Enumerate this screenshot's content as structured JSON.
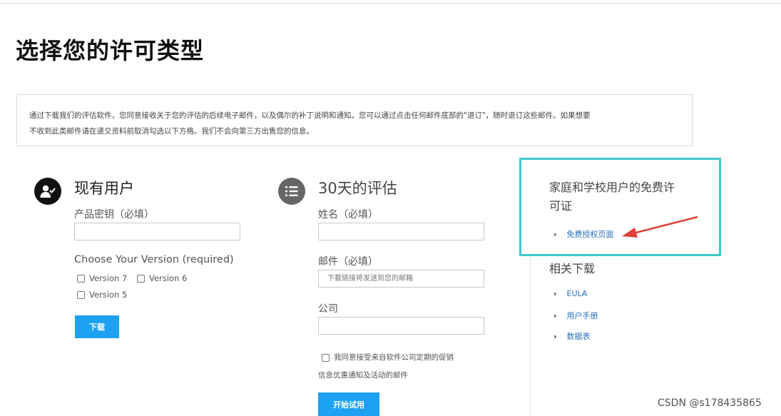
{
  "page": {
    "title": "选择您的许可类型",
    "notice_line1": "通过下载我们的评估软件，您同意接收关于您的评估的后续电子邮件，以及偶尔的补丁说明和通知。您可以通过点击任何邮件底部的\"退订\"，随时退订这些邮件。如果想要",
    "notice_line2": "不收到此类邮件请在递交资料前取消勾选以下方格。我们不会向第三方出售您的信息。"
  },
  "existing_user": {
    "title": "现有用户",
    "icon": "user-check-icon",
    "product_key_label": "产品密钥（必填）",
    "product_key_value": "",
    "version_label": "Choose Your Version (required)",
    "versions": [
      "Version 7",
      "Version 6",
      "Version 5"
    ],
    "download_button": "下载"
  },
  "trial": {
    "title": "30天的评估",
    "icon": "checklist-icon",
    "name_label": "姓名（必填）",
    "name_value": "",
    "email_label": "邮件（必填）",
    "email_placeholder": "下载链接将发送到您的邮箱",
    "company_label": "公司",
    "company_value": "",
    "consent_line1": "我同意接受来自软件公司定期的促销",
    "consent_line2": "信息优惠通知及活动的邮件",
    "start_button": "开始试用"
  },
  "sidebar": {
    "free_title_line1": "家庭和学校用户的免费许",
    "free_title_line2": "可证",
    "free_link": "免费授权页面",
    "downloads_title": "相关下载",
    "downloads": [
      "EULA",
      "用户手册",
      "数据表"
    ]
  },
  "colors": {
    "highlight_border": "#3ec8cc",
    "button": "#1da1f2",
    "arrow": "#e0413a",
    "link": "#2a6fb7"
  },
  "watermark": "CSDN @s178435865"
}
